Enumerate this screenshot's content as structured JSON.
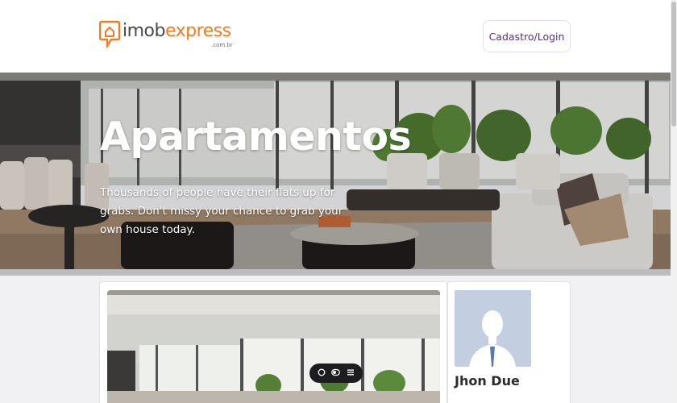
{
  "header": {
    "logo": {
      "part1": "imob",
      "part2": "express",
      "sub": ".com.br"
    },
    "login_label": "Cadastro/Login"
  },
  "hero": {
    "title": "Apartamentos",
    "subtitle": "Thousands of people have their flats up for grabs. Don't missy your chance to grab your own house today."
  },
  "listing": {
    "toolbar_icons": [
      "chat-icon",
      "toggle-icon",
      "menu-icon"
    ]
  },
  "agent": {
    "name": "Jhon Due"
  },
  "colors": {
    "brand_orange": "#f47b20",
    "brand_gray": "#4a4a4a",
    "login_text": "#5b2d86"
  }
}
